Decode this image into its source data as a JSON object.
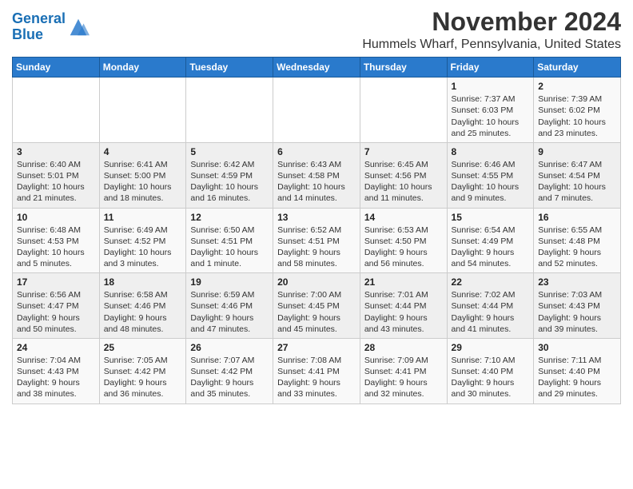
{
  "logo": {
    "line1": "General",
    "line2": "Blue"
  },
  "title": "November 2024",
  "subtitle": "Hummels Wharf, Pennsylvania, United States",
  "weekdays": [
    "Sunday",
    "Monday",
    "Tuesday",
    "Wednesday",
    "Thursday",
    "Friday",
    "Saturday"
  ],
  "weeks": [
    [
      {
        "day": "",
        "info": ""
      },
      {
        "day": "",
        "info": ""
      },
      {
        "day": "",
        "info": ""
      },
      {
        "day": "",
        "info": ""
      },
      {
        "day": "",
        "info": ""
      },
      {
        "day": "1",
        "info": "Sunrise: 7:37 AM\nSunset: 6:03 PM\nDaylight: 10 hours and 25 minutes."
      },
      {
        "day": "2",
        "info": "Sunrise: 7:39 AM\nSunset: 6:02 PM\nDaylight: 10 hours and 23 minutes."
      }
    ],
    [
      {
        "day": "3",
        "info": "Sunrise: 6:40 AM\nSunset: 5:01 PM\nDaylight: 10 hours and 21 minutes."
      },
      {
        "day": "4",
        "info": "Sunrise: 6:41 AM\nSunset: 5:00 PM\nDaylight: 10 hours and 18 minutes."
      },
      {
        "day": "5",
        "info": "Sunrise: 6:42 AM\nSunset: 4:59 PM\nDaylight: 10 hours and 16 minutes."
      },
      {
        "day": "6",
        "info": "Sunrise: 6:43 AM\nSunset: 4:58 PM\nDaylight: 10 hours and 14 minutes."
      },
      {
        "day": "7",
        "info": "Sunrise: 6:45 AM\nSunset: 4:56 PM\nDaylight: 10 hours and 11 minutes."
      },
      {
        "day": "8",
        "info": "Sunrise: 6:46 AM\nSunset: 4:55 PM\nDaylight: 10 hours and 9 minutes."
      },
      {
        "day": "9",
        "info": "Sunrise: 6:47 AM\nSunset: 4:54 PM\nDaylight: 10 hours and 7 minutes."
      }
    ],
    [
      {
        "day": "10",
        "info": "Sunrise: 6:48 AM\nSunset: 4:53 PM\nDaylight: 10 hours and 5 minutes."
      },
      {
        "day": "11",
        "info": "Sunrise: 6:49 AM\nSunset: 4:52 PM\nDaylight: 10 hours and 3 minutes."
      },
      {
        "day": "12",
        "info": "Sunrise: 6:50 AM\nSunset: 4:51 PM\nDaylight: 10 hours and 1 minute."
      },
      {
        "day": "13",
        "info": "Sunrise: 6:52 AM\nSunset: 4:51 PM\nDaylight: 9 hours and 58 minutes."
      },
      {
        "day": "14",
        "info": "Sunrise: 6:53 AM\nSunset: 4:50 PM\nDaylight: 9 hours and 56 minutes."
      },
      {
        "day": "15",
        "info": "Sunrise: 6:54 AM\nSunset: 4:49 PM\nDaylight: 9 hours and 54 minutes."
      },
      {
        "day": "16",
        "info": "Sunrise: 6:55 AM\nSunset: 4:48 PM\nDaylight: 9 hours and 52 minutes."
      }
    ],
    [
      {
        "day": "17",
        "info": "Sunrise: 6:56 AM\nSunset: 4:47 PM\nDaylight: 9 hours and 50 minutes."
      },
      {
        "day": "18",
        "info": "Sunrise: 6:58 AM\nSunset: 4:46 PM\nDaylight: 9 hours and 48 minutes."
      },
      {
        "day": "19",
        "info": "Sunrise: 6:59 AM\nSunset: 4:46 PM\nDaylight: 9 hours and 47 minutes."
      },
      {
        "day": "20",
        "info": "Sunrise: 7:00 AM\nSunset: 4:45 PM\nDaylight: 9 hours and 45 minutes."
      },
      {
        "day": "21",
        "info": "Sunrise: 7:01 AM\nSunset: 4:44 PM\nDaylight: 9 hours and 43 minutes."
      },
      {
        "day": "22",
        "info": "Sunrise: 7:02 AM\nSunset: 4:44 PM\nDaylight: 9 hours and 41 minutes."
      },
      {
        "day": "23",
        "info": "Sunrise: 7:03 AM\nSunset: 4:43 PM\nDaylight: 9 hours and 39 minutes."
      }
    ],
    [
      {
        "day": "24",
        "info": "Sunrise: 7:04 AM\nSunset: 4:43 PM\nDaylight: 9 hours and 38 minutes."
      },
      {
        "day": "25",
        "info": "Sunrise: 7:05 AM\nSunset: 4:42 PM\nDaylight: 9 hours and 36 minutes."
      },
      {
        "day": "26",
        "info": "Sunrise: 7:07 AM\nSunset: 4:42 PM\nDaylight: 9 hours and 35 minutes."
      },
      {
        "day": "27",
        "info": "Sunrise: 7:08 AM\nSunset: 4:41 PM\nDaylight: 9 hours and 33 minutes."
      },
      {
        "day": "28",
        "info": "Sunrise: 7:09 AM\nSunset: 4:41 PM\nDaylight: 9 hours and 32 minutes."
      },
      {
        "day": "29",
        "info": "Sunrise: 7:10 AM\nSunset: 4:40 PM\nDaylight: 9 hours and 30 minutes."
      },
      {
        "day": "30",
        "info": "Sunrise: 7:11 AM\nSunset: 4:40 PM\nDaylight: 9 hours and 29 minutes."
      }
    ]
  ]
}
